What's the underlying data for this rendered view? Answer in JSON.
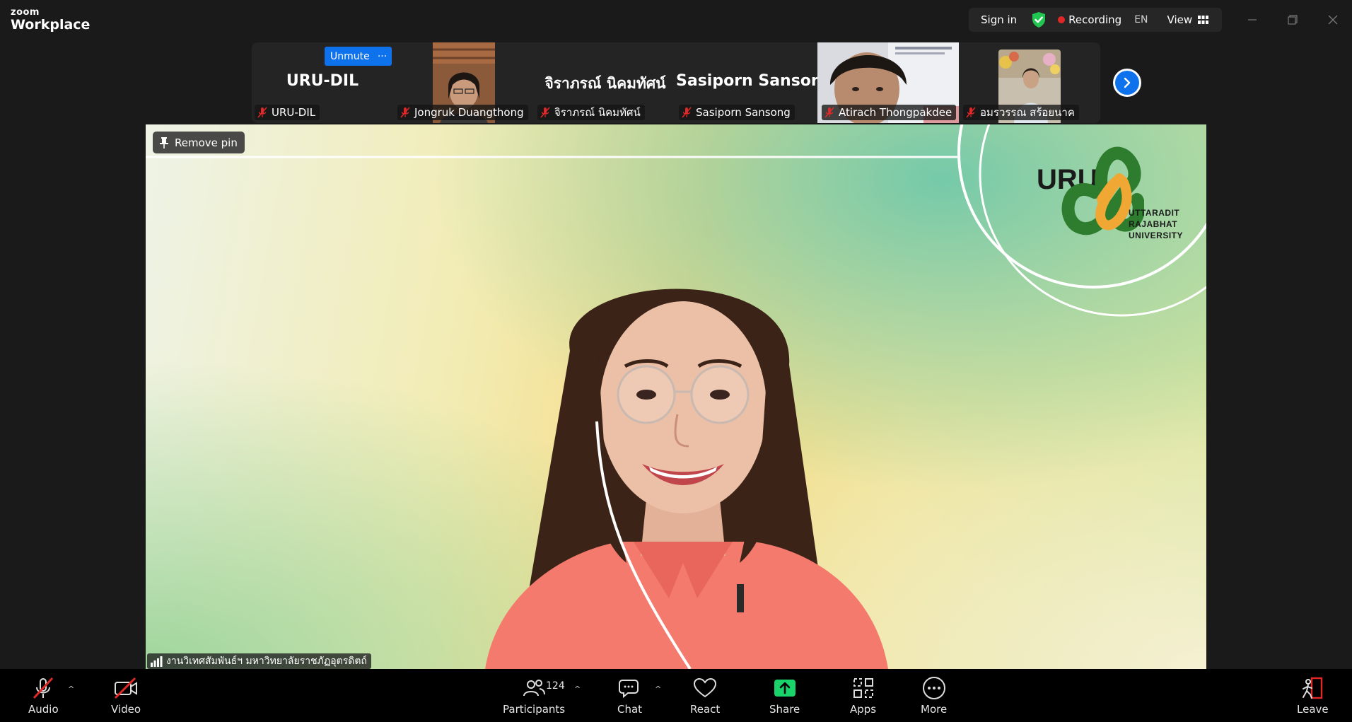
{
  "titlebar": {
    "brand_top": "zoom",
    "brand_bottom": "Workplace",
    "sign_in": "Sign in",
    "recording": "Recording",
    "language": "EN",
    "view": "View"
  },
  "thumbnails": [
    {
      "big_name": "URU-DIL",
      "label": "URU-DIL",
      "muted": true,
      "has_video": false,
      "unmute": "Unmute",
      "more": "···"
    },
    {
      "big_name": "",
      "label": "Jongruk Duangthong",
      "muted": true,
      "has_video": true
    },
    {
      "big_name": "จิราภรณ์ นิคมทัศน์",
      "label": "จิราภรณ์ นิคมทัศน์",
      "muted": true,
      "has_video": false
    },
    {
      "big_name": "Sasiporn Sansong",
      "label": "Sasiporn Sansong",
      "muted": true,
      "has_video": false
    },
    {
      "big_name": "",
      "label": "Atirach Thongpakdee",
      "muted": true,
      "has_video": true
    },
    {
      "big_name": "",
      "label": "อมรวรรณ สร้อยนาค",
      "muted": true,
      "has_video": true
    }
  ],
  "main_video": {
    "remove_pin": "Remove pin",
    "speaker_label": "งานวิเทศสัมพันธ์ฯ มหาวิทยาลัยราชภัฏอุตรดิตถ์",
    "logo_text": "URU",
    "logo_sub": [
      "UTTARADIT",
      "RAJABHAT",
      "UNIVERSITY"
    ]
  },
  "toolbar": {
    "audio": "Audio",
    "video": "Video",
    "participants": "Participants",
    "participants_count": "124",
    "chat": "Chat",
    "react": "React",
    "share": "Share",
    "apps": "Apps",
    "more": "More",
    "leave": "Leave"
  },
  "colors": {
    "accent_blue": "#0e72ed",
    "share_green": "#19d36b",
    "recording_red": "#e02828",
    "mute_red": "#e02828",
    "shield_green": "#23c552",
    "logo_green": "#2e7d2f",
    "logo_orange": "#f0a733"
  }
}
